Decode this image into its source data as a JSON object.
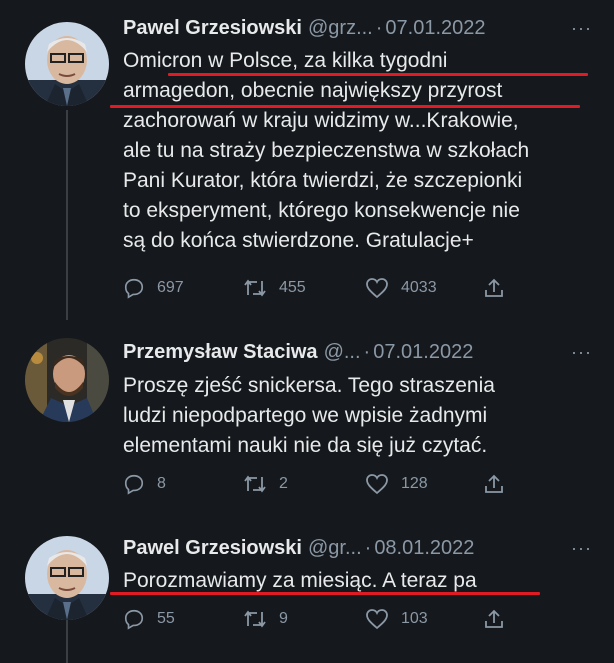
{
  "tweets": [
    {
      "author": "Pawel Grzesiowski",
      "handle": "@grz...",
      "separator": "·",
      "date": "07.01.2022",
      "more": "···",
      "lines": [
        "Omicron w Polsce, za kilka tygodni",
        "armagedon, obecnie największy przyrost",
        "zachorowań w kraju widzimy w...Krakowie,",
        "ale tu na straży bezpieczenstwa w szkołach",
        "Pani Kurator, która twierdzi, że szczepionki",
        "to eksperyment, którego konsekwencje nie",
        "są do końca stwierdzone. Gratulacje+"
      ],
      "replies": "697",
      "retweets": "455",
      "likes": "4033"
    },
    {
      "author": "Przemysław Staciwa",
      "handle": "@...",
      "separator": "·",
      "date": "07.01.2022",
      "more": "···",
      "lines": [
        "Proszę zjeść snickersa. Tego straszenia",
        "ludzi niepodpartego we wpisie żadnymi",
        "elementami nauki nie da się już czytać."
      ],
      "replies": "8",
      "retweets": "2",
      "likes": "128"
    },
    {
      "author": "Pawel Grzesiowski",
      "handle": "@gr...",
      "separator": "·",
      "date": "08.01.2022",
      "more": "···",
      "lines": [
        "Porozmawiamy za miesiąc. A teraz pa"
      ],
      "replies": "55",
      "retweets": "9",
      "likes": "103"
    }
  ],
  "colors": {
    "background": "#15181c",
    "text": "#e7e9ea",
    "muted": "#8b98a5",
    "underline_annotation": "#e01b24"
  },
  "icons": [
    "reply-icon",
    "retweet-icon",
    "like-icon",
    "share-icon",
    "more-icon"
  ]
}
